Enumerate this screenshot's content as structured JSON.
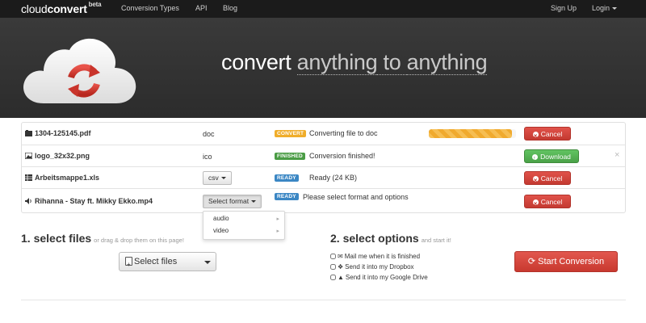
{
  "nav": {
    "brand_light": "cloud",
    "brand_bold": "convert",
    "brand_beta": "beta",
    "links": [
      "Conversion Types",
      "API",
      "Blog"
    ],
    "sign_up": "Sign Up",
    "login": "Login"
  },
  "hero": {
    "tagline_prefix": "convert ",
    "tagline_word1": "anything",
    "tagline_mid": " to ",
    "tagline_word2": "anything"
  },
  "files": [
    {
      "name": "1304-125145.pdf",
      "icon": "pdf-file-icon",
      "format": "doc",
      "badge": "CONVERT",
      "status": "Converting file to doc",
      "progress": 0.95,
      "action": "Cancel"
    },
    {
      "name": "logo_32x32.png",
      "icon": "image-file-icon",
      "format": "ico",
      "badge": "FINISHED",
      "status": "Conversion finished!",
      "action": "Download",
      "close": "×"
    },
    {
      "name": "Arbeitsmappe1.xls",
      "icon": "spreadsheet-file-icon",
      "format": "csv",
      "badge": "READY",
      "status": "Ready (24 KB)",
      "action": "Cancel"
    },
    {
      "name": "Rihanna - Stay ft. Mikky Ekko.mp4",
      "icon": "audio-file-icon",
      "format": "Select format",
      "badge": "READY",
      "status": "Please select format and options",
      "action": "Cancel"
    }
  ],
  "format_dropdown": {
    "items": [
      "audio",
      "video"
    ]
  },
  "step1": {
    "title": "1. select files",
    "subtitle": "or drag & drop them on this page!",
    "select_label": "Select files"
  },
  "step2": {
    "title": "2. select options",
    "subtitle": "and start it!",
    "options": [
      {
        "label": "Mail me when it is finished",
        "icon": "mail-icon",
        "checked": false
      },
      {
        "label": "Send it into my Dropbox",
        "icon": "dropbox-icon",
        "checked": false
      },
      {
        "label": "Send it into my Google Drive",
        "icon": "google-drive-icon",
        "checked": false
      }
    ],
    "start_label": "Start Conversion"
  },
  "colors": {
    "convert_badge": "#f0ad2a",
    "finished_badge": "#4a9c45",
    "ready_badge": "#3b87c4",
    "cancel": "#c43a31",
    "download": "#4aa148",
    "accent_red": "#d63b2f"
  }
}
